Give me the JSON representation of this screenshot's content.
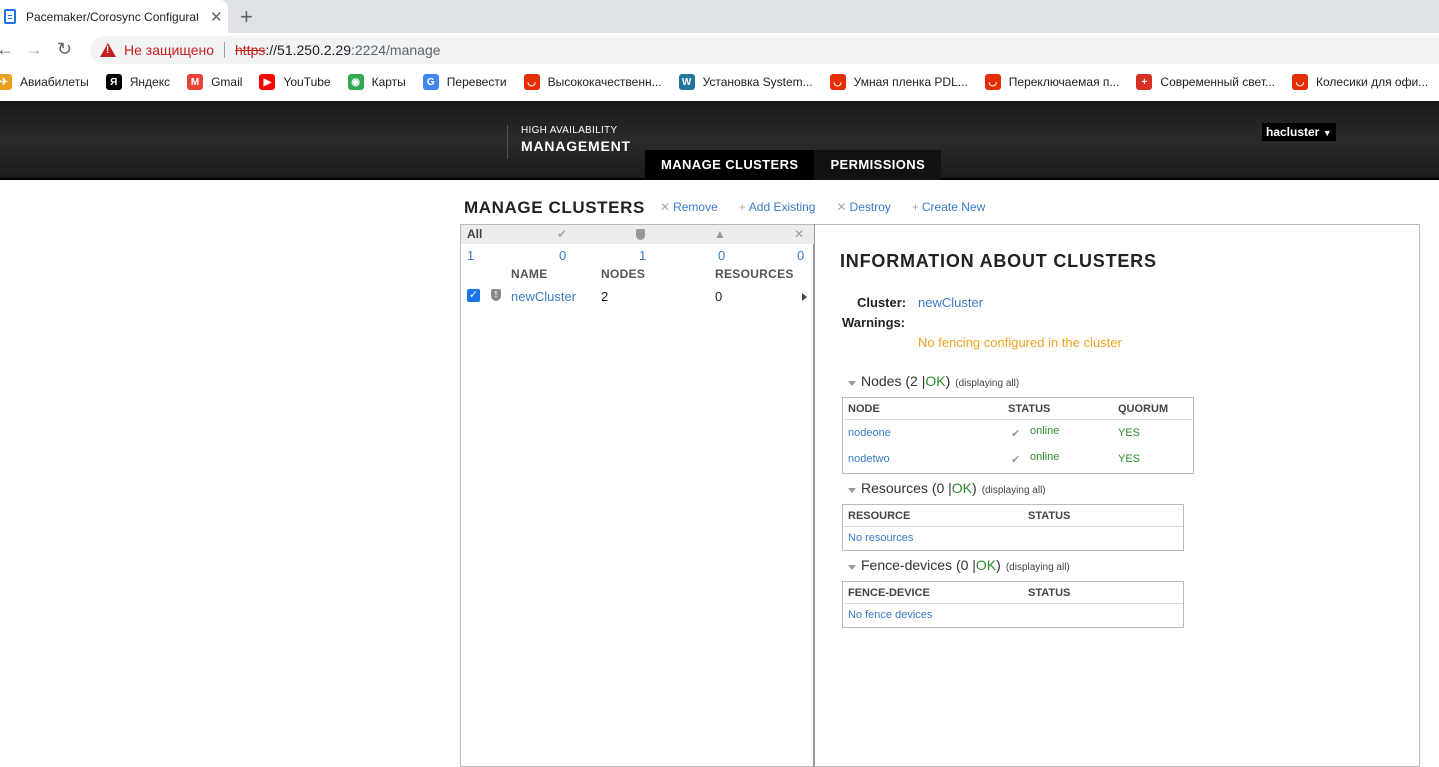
{
  "browser": {
    "tab_title": "Pacemaker/Corosync Configurati",
    "tab_close": "✕",
    "new_tab": "+",
    "not_secure": "Не защищено",
    "url_scheme": "https",
    "url_host": "://51.250.2.29",
    "url_port_path": ":2224/manage",
    "bookmarks": [
      {
        "label": "Авиабилеты",
        "icon": "plane-icon",
        "color": "#e8a020"
      },
      {
        "label": "Яндекс",
        "icon": "yandex-icon",
        "color": "#000000"
      },
      {
        "label": "Gmail",
        "icon": "gmail-icon",
        "color": "#ea4335"
      },
      {
        "label": "YouTube",
        "icon": "youtube-icon",
        "color": "#ff0000"
      },
      {
        "label": "Карты",
        "icon": "maps-icon",
        "color": "#34a853"
      },
      {
        "label": "Перевести",
        "icon": "translate-icon",
        "color": "#4285f4"
      },
      {
        "label": "Высококачественн...",
        "icon": "aliexpress-icon",
        "color": "#e62e04"
      },
      {
        "label": "Установка System...",
        "icon": "wordpress-icon",
        "color": "#21759b"
      },
      {
        "label": "Умная пленка PDL...",
        "icon": "aliexpress-icon",
        "color": "#e62e04"
      },
      {
        "label": "Переключаемая п...",
        "icon": "aliexpress-icon",
        "color": "#e62e04"
      },
      {
        "label": "Современный свет...",
        "icon": "plus-circle-icon",
        "color": "#d93025"
      },
      {
        "label": "Колесики для офи...",
        "icon": "aliexpress-icon",
        "color": "#e62e04"
      }
    ]
  },
  "header": {
    "brand_small": "HIGH AVAILABILITY",
    "brand_big": "MANAGEMENT",
    "nav": [
      "MANAGE CLUSTERS",
      "PERMISSIONS"
    ],
    "user": "hacluster"
  },
  "page": {
    "title": "MANAGE CLUSTERS",
    "actions": [
      {
        "sym": "✕",
        "label": "Remove"
      },
      {
        "sym": "+",
        "label": "Add Existing"
      },
      {
        "sym": "✕",
        "label": "Destroy"
      },
      {
        "sym": "+",
        "label": "Create New"
      }
    ]
  },
  "summary": {
    "all_label": "All",
    "counts": {
      "all": "1",
      "ok": "0",
      "warning": "1",
      "error": "0",
      "unknown": "0"
    }
  },
  "cluster_table": {
    "columns": [
      "NAME",
      "NODES",
      "RESOURCES"
    ],
    "rows": [
      {
        "name": "newCluster",
        "nodes": "2",
        "resources": "0"
      }
    ]
  },
  "info": {
    "title": "INFORMATION ABOUT CLUSTERS",
    "cluster_label": "Cluster:",
    "cluster_name": "newCluster",
    "warnings_label": "Warnings:",
    "warning": "No fencing configured in the cluster",
    "nodes_section": {
      "name": "Nodes",
      "open": "(2 | ",
      "status": "OK",
      "close": ")",
      "display": "(displaying all)"
    },
    "nodes_columns": [
      "NODE",
      "STATUS",
      "QUORUM"
    ],
    "nodes": [
      {
        "name": "nodeone",
        "status": "online",
        "quorum": "YES"
      },
      {
        "name": "nodetwo",
        "status": "online",
        "quorum": "YES"
      }
    ],
    "resources_section": {
      "name": "Resources",
      "open": "(0 | ",
      "status": "OK",
      "close": ")",
      "display": "(displaying all)"
    },
    "resources_columns": [
      "RESOURCE",
      "STATUS"
    ],
    "resources_empty": "No resources",
    "fence_section": {
      "name": "Fence-devices",
      "open": "(0 | ",
      "status": "OK",
      "close": ")",
      "display": "(displaying all)"
    },
    "fence_columns": [
      "FENCE-DEVICE",
      "STATUS"
    ],
    "fence_empty": "No fence devices"
  }
}
